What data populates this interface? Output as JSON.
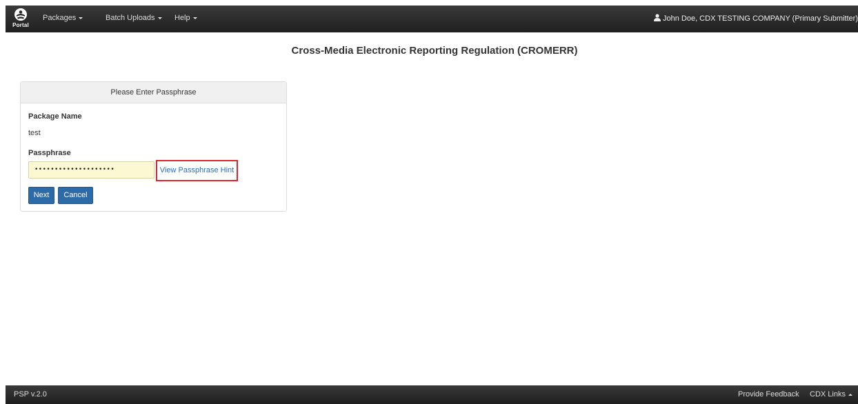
{
  "header": {
    "logo_text": "Portal",
    "nav": [
      {
        "label": "Packages"
      },
      {
        "label": "Batch Uploads"
      },
      {
        "label": "Help"
      }
    ],
    "user_label": "John Doe, CDX TESTING COMPANY (Primary Submitter)",
    "user_icon": "user-icon"
  },
  "page": {
    "title": "Cross-Media Electronic Reporting Regulation (CROMERR)"
  },
  "panel": {
    "heading": "Please Enter Passphrase",
    "package_name_label": "Package Name",
    "package_name_value": "test",
    "passphrase_label": "Passphrase",
    "passphrase_masked": "••••••••••••••••••••",
    "hint_link": "View Passphrase Hint",
    "next_button": "Next",
    "cancel_button": "Cancel"
  },
  "footer": {
    "version": "PSP  v.2.0",
    "feedback": "Provide Feedback",
    "cdx_links": "CDX Links"
  },
  "colors": {
    "bar_dark": "#262626",
    "button_blue": "#2d6aa8",
    "highlight_red": "#d9232e",
    "input_bg": "#fcf8d2",
    "link_blue": "#2a6ebb"
  }
}
